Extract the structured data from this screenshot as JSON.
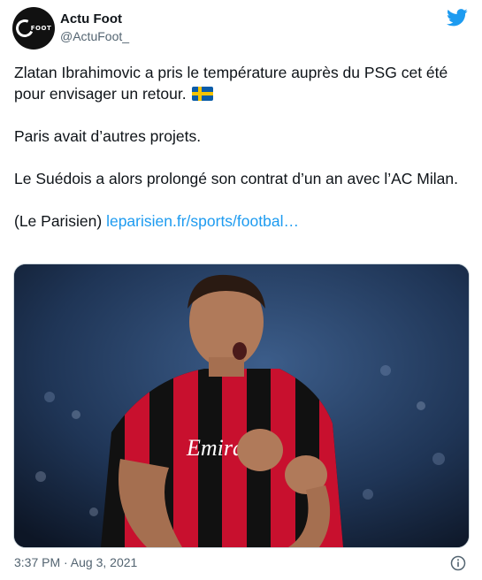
{
  "author": {
    "name": "Actu Foot",
    "handle": "@ActuFoot_",
    "avatar_text": "FOOT"
  },
  "tweet": {
    "line1": "Zlatan Ibrahimovic a pris le température auprès du PSG cet été pour envisager un retour.",
    "flag_icon": "sweden-flag-icon",
    "line2": "Paris avait d’autres projets.",
    "line3": "Le Suédois a alors prolongé son contrat d’un an avec l’AC Milan.",
    "source_prefix": "(Le Parisien) ",
    "link_text": "leparisien.fr/sports/footbal…"
  },
  "media": {
    "shirt_sponsor": "Emirates"
  },
  "footer": {
    "timestamp": "3:37 PM · Aug 3, 2021"
  },
  "colors": {
    "link": "#1d9bf0",
    "twitter_blue": "#1d9bf0",
    "secondary_text": "#536471"
  },
  "icons": {
    "brand": "twitter-bird-icon",
    "info": "info-icon"
  }
}
